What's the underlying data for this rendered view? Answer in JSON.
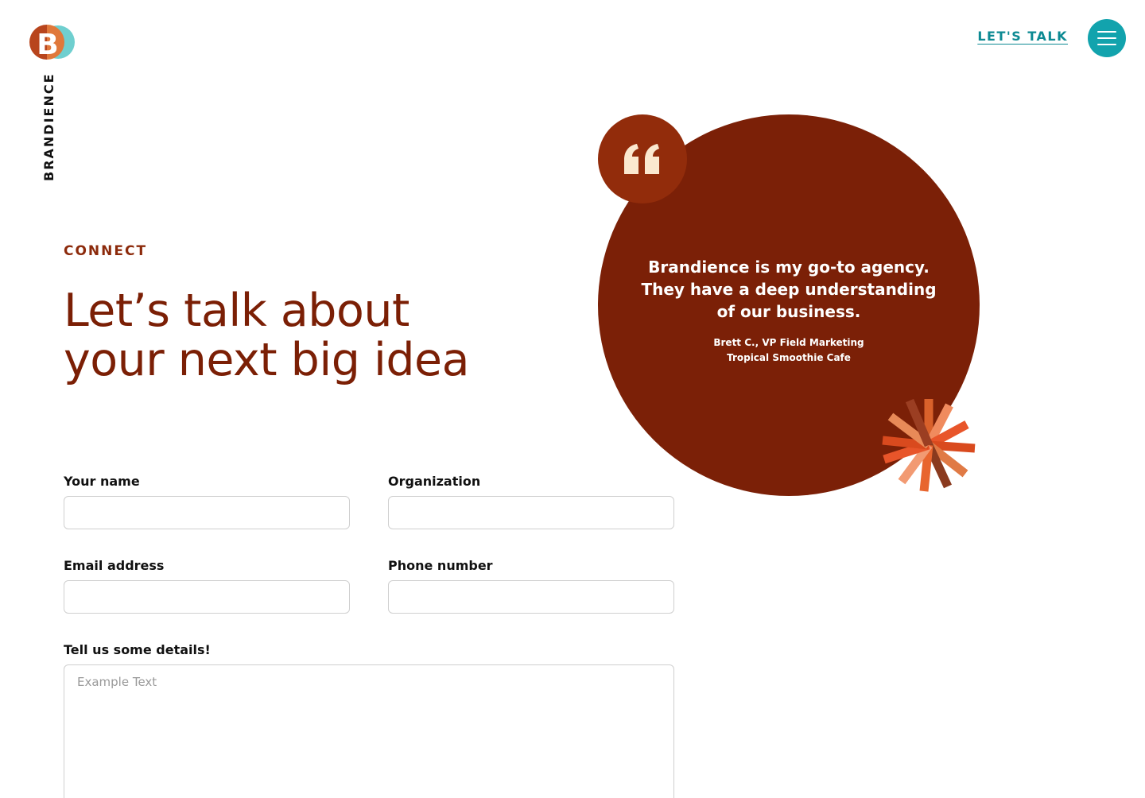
{
  "header": {
    "brand": "BRANDIENCE",
    "cta_label": "LET'S TALK",
    "menu_icon": "hamburger-menu-icon"
  },
  "hero": {
    "eyebrow": "CONNECT",
    "headline_line1": "Let’s talk about",
    "headline_line2": "your next big idea"
  },
  "form": {
    "name_label": "Your name",
    "organization_label": "Organization",
    "email_label": "Email address",
    "phone_label": "Phone number",
    "details_label": "Tell us some details!",
    "details_placeholder": "Example Text"
  },
  "testimonial": {
    "quote_line1": "Brandience is my go-to agency.",
    "quote_line2": "They have a deep understanding",
    "quote_line3": "of our business.",
    "author": "Brett C., VP Field Marketing",
    "company": "Tropical Smoothie Cafe"
  },
  "colors": {
    "brand_red": "#7b2007",
    "accent_teal": "#12a3ad",
    "link_teal": "#0d8a93"
  }
}
